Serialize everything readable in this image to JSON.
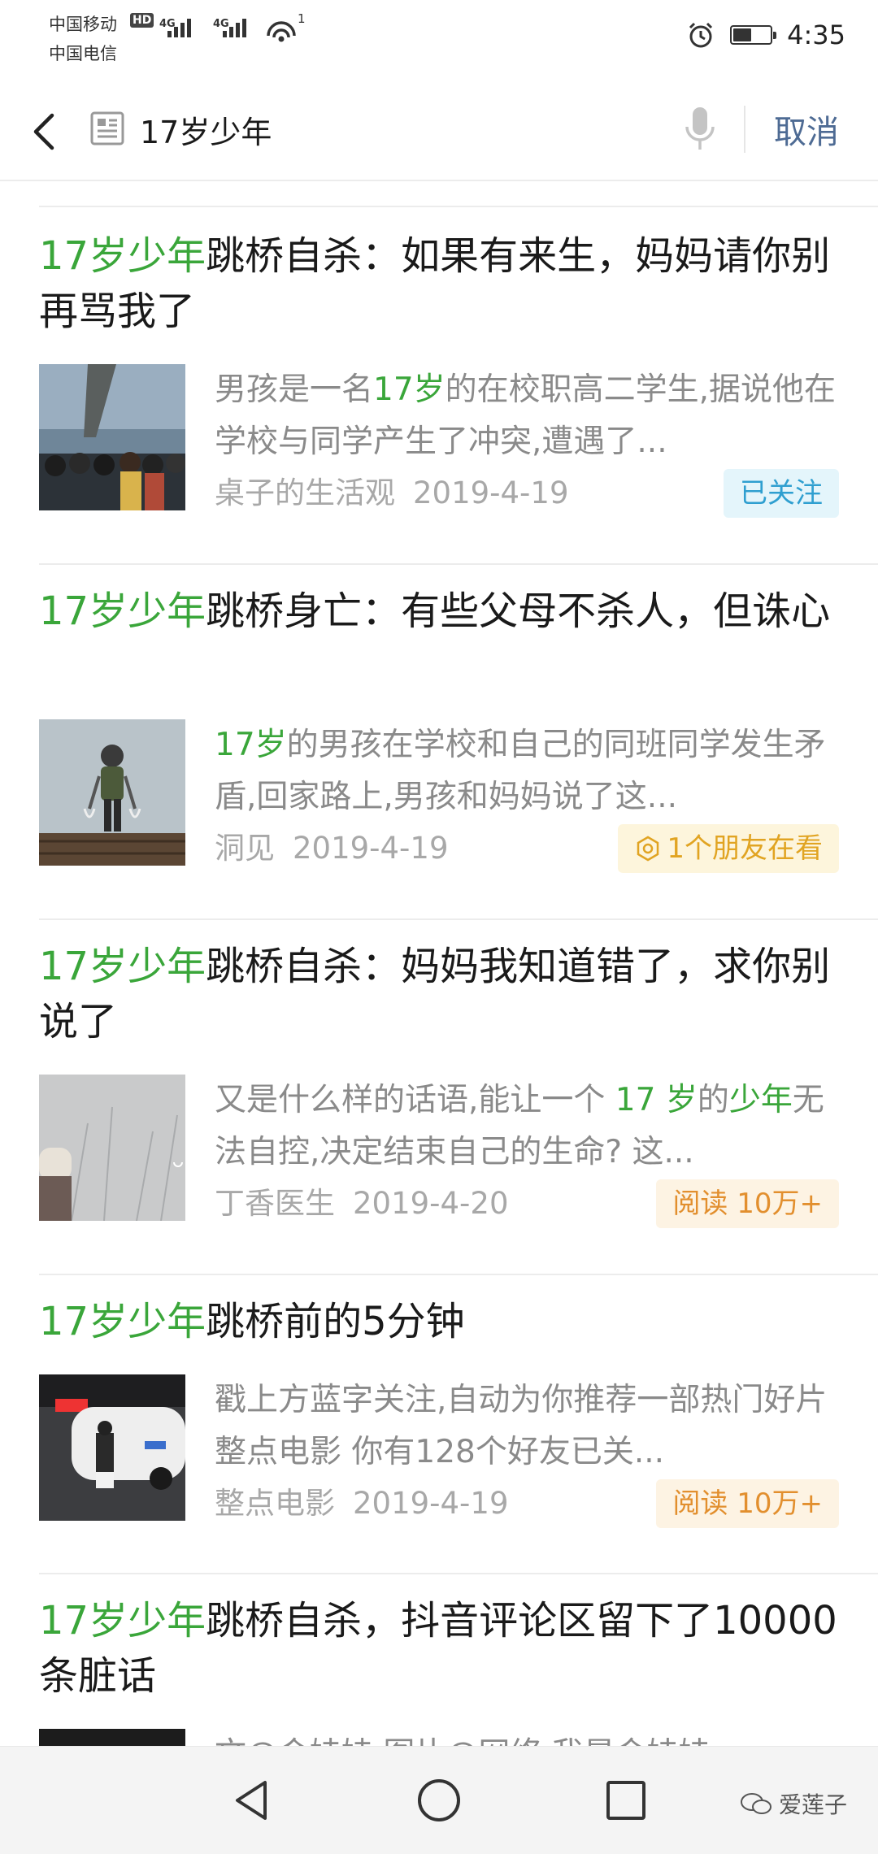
{
  "status_bar": {
    "carrier_1": "中国移动",
    "carrier_2": "中国电信",
    "hd": "HD",
    "net_1": "4G",
    "net_2": "4G",
    "wifi_sub": "1",
    "battery_level": 0.5,
    "time": "4:35"
  },
  "search": {
    "query": "17岁少年",
    "cancel_label": "取消"
  },
  "results": [
    {
      "title_hl": "17岁少年",
      "title_rest": "跳桥自杀：如果有来生，妈妈请你别再骂我了",
      "desc_parts": [
        {
          "t": "男孩是一名",
          "h": false
        },
        {
          "t": "17岁",
          "h": true
        },
        {
          "t": "的在校职高二学生,据说他在学校与同学产生了冲突,遭遇了...",
          "h": false
        }
      ],
      "source": "桌子的生活观",
      "date": "2019-4-19",
      "badge": "已关注",
      "badge_type": "follow"
    },
    {
      "title_hl": "17岁少年",
      "title_rest": "跳桥身亡：有些父母不杀人，但诛心",
      "desc_parts": [
        {
          "t": "17岁",
          "h": true
        },
        {
          "t": "的男孩在学校和自己的同班同学发生矛盾,回家路上,男孩和妈妈说了这...",
          "h": false
        }
      ],
      "source": "洞见",
      "date": "2019-4-19",
      "badge": "1个朋友在看",
      "badge_type": "friends"
    },
    {
      "title_hl": "17岁少年",
      "title_rest": "跳桥自杀：妈妈我知道错了，求你别说了",
      "desc_parts": [
        {
          "t": "又是什么样的话语,能让一个 ",
          "h": false
        },
        {
          "t": "17 岁",
          "h": true
        },
        {
          "t": "的",
          "h": false
        },
        {
          "t": "少年",
          "h": true
        },
        {
          "t": "无法自控,决定结束自己的生命? 这...",
          "h": false
        }
      ],
      "source": "丁香医生",
      "date": "2019-4-20",
      "badge": "阅读 10万+",
      "badge_type": "read"
    },
    {
      "title_hl": "17岁少年",
      "title_rest": "跳桥前的5分钟",
      "desc_parts": [
        {
          "t": "戳上方蓝字关注,自动为你推荐一部热门好片 整点电影 你有128个好友已关...",
          "h": false
        }
      ],
      "source": "整点电影",
      "date": "2019-4-19",
      "badge": "阅读 10万+",
      "badge_type": "read"
    },
    {
      "title_hl": "17岁少年",
      "title_rest": "跳桥自杀，抖音评论区留下了10000条脏话",
      "desc_parts": [
        {
          "t": "文@金娃娃 图片@网络 我是金娃娃...",
          "h": false
        }
      ],
      "source": "",
      "date": "",
      "badge": "",
      "badge_type": ""
    }
  ],
  "watermark": "爱莲子"
}
